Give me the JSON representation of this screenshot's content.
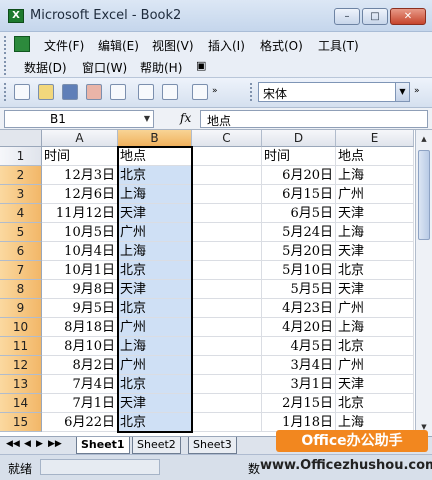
{
  "window": {
    "title": "Microsoft Excel - Book2",
    "minimize": "–",
    "maximize": "□",
    "close": "✕"
  },
  "menu": {
    "row1": [
      "文件(F)",
      "编辑(E)",
      "视图(V)",
      "插入(I)",
      "格式(O)",
      "工具(T)"
    ],
    "row2": [
      "数据(D)",
      "窗口(W)",
      "帮助(H)"
    ],
    "doc_controls": [
      "–",
      "\u0018",
      "✕"
    ]
  },
  "toolbar": {
    "font_name": "宋体"
  },
  "formula_bar": {
    "name_box": "B1",
    "fx_label": "fx",
    "formula": "地点"
  },
  "grid": {
    "columns": [
      "A",
      "B",
      "C",
      "D",
      "E"
    ],
    "active_column": "B",
    "rows": [
      {
        "num": "1",
        "A": "时间",
        "B": "地点",
        "C": "",
        "D": "时间",
        "E": "地点"
      },
      {
        "num": "2",
        "A": "12月3日",
        "B": "北京",
        "C": "",
        "D": "6月20日",
        "E": "上海"
      },
      {
        "num": "3",
        "A": "12月6日",
        "B": "上海",
        "C": "",
        "D": "6月15日",
        "E": "广州"
      },
      {
        "num": "4",
        "A": "11月12日",
        "B": "天津",
        "C": "",
        "D": "6月5日",
        "E": "天津"
      },
      {
        "num": "5",
        "A": "10月5日",
        "B": "广州",
        "C": "",
        "D": "5月24日",
        "E": "上海"
      },
      {
        "num": "6",
        "A": "10月4日",
        "B": "上海",
        "C": "",
        "D": "5月20日",
        "E": "天津"
      },
      {
        "num": "7",
        "A": "10月1日",
        "B": "北京",
        "C": "",
        "D": "5月10日",
        "E": "北京"
      },
      {
        "num": "8",
        "A": "9月8日",
        "B": "天津",
        "C": "",
        "D": "5月5日",
        "E": "天津"
      },
      {
        "num": "9",
        "A": "9月5日",
        "B": "北京",
        "C": "",
        "D": "4月23日",
        "E": "广州"
      },
      {
        "num": "10",
        "A": "8月18日",
        "B": "广州",
        "C": "",
        "D": "4月20日",
        "E": "上海"
      },
      {
        "num": "11",
        "A": "8月10日",
        "B": "上海",
        "C": "",
        "D": "4月5日",
        "E": "北京"
      },
      {
        "num": "12",
        "A": "8月2日",
        "B": "广州",
        "C": "",
        "D": "3月4日",
        "E": "广州"
      },
      {
        "num": "13",
        "A": "7月4日",
        "B": "北京",
        "C": "",
        "D": "3月1日",
        "E": "天津"
      },
      {
        "num": "14",
        "A": "7月1日",
        "B": "天津",
        "C": "",
        "D": "2月15日",
        "E": "北京"
      },
      {
        "num": "15",
        "A": "6月22日",
        "B": "北京",
        "C": "",
        "D": "1月18日",
        "E": "上海"
      }
    ]
  },
  "sheets": {
    "nav": [
      "◀◀",
      "◀",
      "▶",
      "▶▶"
    ],
    "tabs": [
      "Sheet1",
      "Sheet2",
      "Sheet3"
    ],
    "active": "Sheet1"
  },
  "status": {
    "text": "就绪",
    "sum_prefix": "数"
  },
  "watermark": {
    "brand": "Office办公助手",
    "url": "www.Officezhushou.com"
  }
}
